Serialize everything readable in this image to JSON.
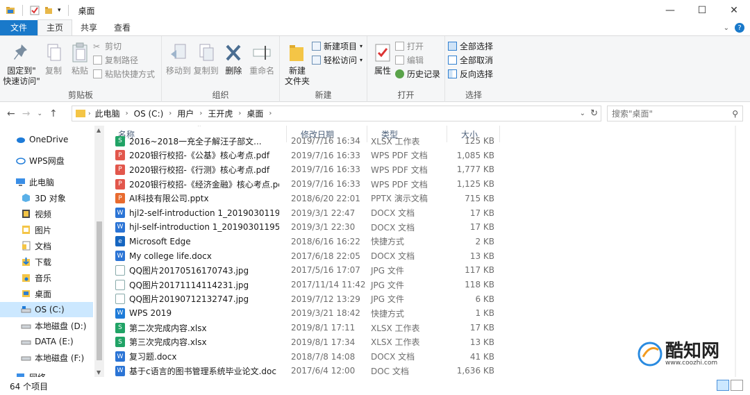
{
  "window": {
    "title": "桌面"
  },
  "tabs": [
    {
      "label": "文件"
    },
    {
      "label": "主页"
    },
    {
      "label": "共享"
    },
    {
      "label": "查看"
    }
  ],
  "ribbon": {
    "clipboard": {
      "pin_label": "固定到\"\n快速访问\"",
      "copy_label": "复制",
      "paste_label": "粘贴",
      "cut_label": "剪切",
      "copy_path_label": "复制路径",
      "paste_shortcut_label": "粘贴快捷方式",
      "group_label": "剪贴板"
    },
    "organize": {
      "move_label": "移动到",
      "copyto_label": "复制到",
      "delete_label": "删除",
      "rename_label": "重命名",
      "group_label": "组织"
    },
    "new": {
      "new_folder_label": "新建\n文件夹",
      "new_item_label": "新建项目",
      "easy_access_label": "轻松访问",
      "group_label": "新建"
    },
    "open": {
      "properties_label": "属性",
      "open_label": "打开",
      "edit_label": "编辑",
      "history_label": "历史记录",
      "group_label": "打开"
    },
    "select": {
      "select_all_label": "全部选择",
      "select_none_label": "全部取消",
      "invert_label": "反向选择",
      "group_label": "选择"
    }
  },
  "address": {
    "crumbs": [
      "此电脑",
      "OS (C:)",
      "用户",
      "王开虎",
      "桌面"
    ],
    "search_placeholder": "搜索\"桌面\""
  },
  "sidebar": {
    "items": [
      {
        "label": "OneDrive",
        "icon": "cloud-icon"
      },
      {
        "label": "WPS网盘",
        "icon": "cloud-icon"
      },
      {
        "label": "此电脑",
        "icon": "computer-icon"
      },
      {
        "label": "3D 对象",
        "icon": "cube-icon"
      },
      {
        "label": "视频",
        "icon": "video-icon"
      },
      {
        "label": "图片",
        "icon": "image-icon"
      },
      {
        "label": "文档",
        "icon": "document-icon"
      },
      {
        "label": "下载",
        "icon": "download-icon"
      },
      {
        "label": "音乐",
        "icon": "music-icon"
      },
      {
        "label": "桌面",
        "icon": "desktop-icon"
      },
      {
        "label": "OS (C:)",
        "icon": "drive-icon"
      },
      {
        "label": "本地磁盘 (D:)",
        "icon": "drive-icon"
      },
      {
        "label": "DATA (E:)",
        "icon": "drive-icon"
      },
      {
        "label": "本地磁盘 (F:)",
        "icon": "drive-icon"
      },
      {
        "label": "网络",
        "icon": "network-icon"
      }
    ]
  },
  "columns": {
    "name": "名称",
    "date": "修改日期",
    "type": "类型",
    "size": "大小"
  },
  "files": [
    {
      "name": "2016~2018一充全子解汪子部文...",
      "date": "2019/7/16 16:34",
      "type": "XLSX 工作表",
      "size": "125 KB",
      "icon": "xlsx"
    },
    {
      "name": "2020银行校招-《公基》核心考点.pdf",
      "date": "2019/7/16 16:33",
      "type": "WPS PDF 文档",
      "size": "1,085 KB",
      "icon": "pdf"
    },
    {
      "name": "2020银行校招-《行测》核心考点.pdf",
      "date": "2019/7/16 16:33",
      "type": "WPS PDF 文档",
      "size": "1,777 KB",
      "icon": "pdf"
    },
    {
      "name": "2020银行校招-《经济金融》核心考点.pdf",
      "date": "2019/7/16 16:33",
      "type": "WPS PDF 文档",
      "size": "1,125 KB",
      "icon": "pdf"
    },
    {
      "name": "AI科技有限公司.pptx",
      "date": "2018/6/20 22:01",
      "type": "PPTX 演示文稿",
      "size": "715 KB",
      "icon": "pptx"
    },
    {
      "name": "hjl2-self-introduction 1_2019030119...",
      "date": "2019/3/1 22:47",
      "type": "DOCX 文档",
      "size": "17 KB",
      "icon": "docx"
    },
    {
      "name": "hjl-self-introduction 1_20190301195...",
      "date": "2019/3/1 22:30",
      "type": "DOCX 文档",
      "size": "17 KB",
      "icon": "docx"
    },
    {
      "name": "Microsoft Edge",
      "date": "2018/6/16 16:22",
      "type": "快捷方式",
      "size": "2 KB",
      "icon": "edge"
    },
    {
      "name": "My college life.docx",
      "date": "2017/6/18 22:05",
      "type": "DOCX 文档",
      "size": "13 KB",
      "icon": "docx"
    },
    {
      "name": "QQ图片20170516170743.jpg",
      "date": "2017/5/16 17:07",
      "type": "JPG 文件",
      "size": "117 KB",
      "icon": "jpg"
    },
    {
      "name": "QQ图片20171114114231.jpg",
      "date": "2017/11/14 11:42",
      "type": "JPG 文件",
      "size": "118 KB",
      "icon": "jpg"
    },
    {
      "name": "QQ图片20190712132747.jpg",
      "date": "2019/7/12 13:29",
      "type": "JPG 文件",
      "size": "6 KB",
      "icon": "jpg"
    },
    {
      "name": "WPS 2019",
      "date": "2019/3/21 18:42",
      "type": "快捷方式",
      "size": "1 KB",
      "icon": "wps"
    },
    {
      "name": "第二次完成内容.xlsx",
      "date": "2019/8/1 17:11",
      "type": "XLSX 工作表",
      "size": "17 KB",
      "icon": "xlsx"
    },
    {
      "name": "第三次完成内容.xlsx",
      "date": "2019/8/1 17:34",
      "type": "XLSX 工作表",
      "size": "13 KB",
      "icon": "xlsx"
    },
    {
      "name": "复习题.docx",
      "date": "2018/7/8 14:08",
      "type": "DOCX 文档",
      "size": "41 KB",
      "icon": "docx"
    },
    {
      "name": "基于c语言的图书管理系统毕业论文.doc",
      "date": "2017/6/4 12:00",
      "type": "DOC 文档",
      "size": "1,636 KB",
      "icon": "docx"
    }
  ],
  "status": {
    "count": "64 个项目"
  },
  "watermark": {
    "text": "酷知网",
    "url": "www.coozhi.com"
  }
}
